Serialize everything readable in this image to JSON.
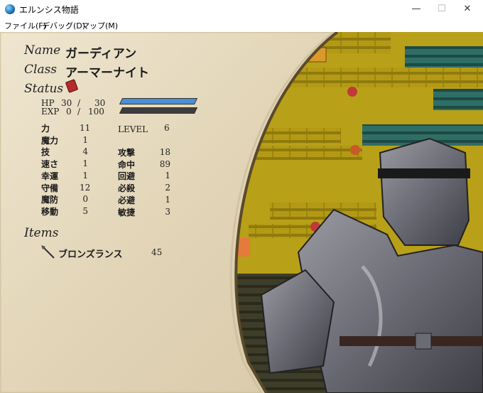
{
  "window": {
    "title": "エルンシス物語",
    "minimize": "—",
    "maximize": "☐",
    "close": "✕"
  },
  "menu": [
    "ファイル(F)",
    "デバッグ(D)",
    "マップ(M)"
  ],
  "unit": {
    "name_label": "Name",
    "name": "ガーディアン",
    "class_label": "Class",
    "class": "アーマーナイト",
    "status_label": "Status",
    "hp_label": "HP",
    "hp_current": "30",
    "hp_sep": "/",
    "hp_max": "30",
    "exp_label": "EXP",
    "exp_current": "0",
    "exp_sep": "/",
    "exp_max": "100",
    "hp_fraction": 1.0,
    "exp_fraction": 0.0,
    "level_label": "LEVEL",
    "level": "6",
    "stats_left": [
      {
        "label": "力",
        "value": "11"
      },
      {
        "label": "魔力",
        "value": "1"
      },
      {
        "label": "技",
        "value": "4"
      },
      {
        "label": "速さ",
        "value": "1"
      },
      {
        "label": "幸運",
        "value": "1"
      },
      {
        "label": "守備",
        "value": "12"
      },
      {
        "label": "魔防",
        "value": "0"
      },
      {
        "label": "移動",
        "value": "5"
      }
    ],
    "stats_right": [
      {
        "label": "攻撃",
        "value": "18"
      },
      {
        "label": "命中",
        "value": "89"
      },
      {
        "label": "回避",
        "value": "1"
      },
      {
        "label": "必殺",
        "value": "2"
      },
      {
        "label": "必避",
        "value": "1"
      },
      {
        "label": "敏捷",
        "value": "3"
      }
    ],
    "items_label": "Items",
    "items": [
      {
        "name": "ブロンズランス",
        "uses": "45",
        "icon": "lance-icon"
      }
    ]
  },
  "colors": {
    "parchment": "#e8dcc4",
    "hp_bar": "#4a8fd8",
    "exp_bar": "#5a5a5a"
  }
}
